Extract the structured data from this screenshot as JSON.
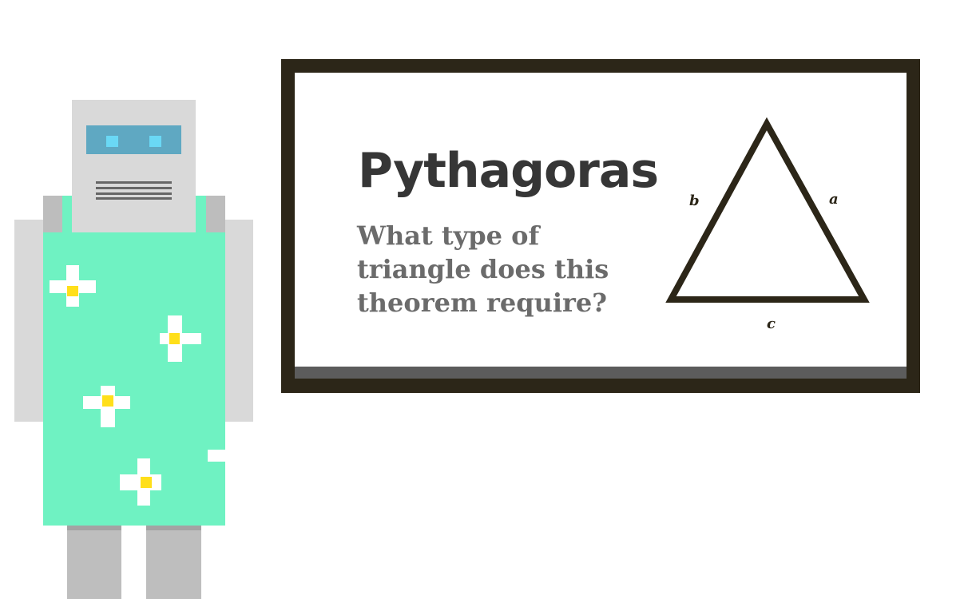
{
  "slide": {
    "title": "Pythagoras",
    "question": "What type of triangle does this theorem require?"
  },
  "triangle": {
    "side_labels": {
      "a": "a",
      "b": "b",
      "c": "c"
    }
  },
  "colors": {
    "board_frame": "#2c2618",
    "board_ledge": "#5c5c5c",
    "title": "#363636",
    "question": "#6b6b6b",
    "robot_dress": "#6ff2c2",
    "robot_body": "#d9d9d9",
    "robot_visor": "#5fa8c2",
    "robot_eyes": "#6ad8f5",
    "flower_center": "#ffdf1a"
  }
}
